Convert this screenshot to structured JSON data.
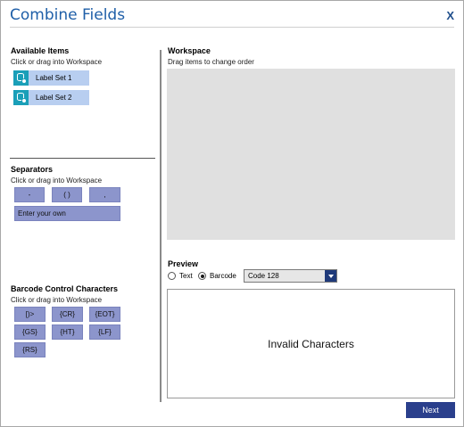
{
  "dialog": {
    "title": "Combine Fields",
    "close_label": "X"
  },
  "available_items": {
    "title": "Available Items",
    "subtitle": "Click or drag into Workspace",
    "items": [
      {
        "label": "Label Set 1",
        "icon": "database-icon"
      },
      {
        "label": "Label Set 2",
        "icon": "database-icon"
      }
    ]
  },
  "separators": {
    "title": "Separators",
    "subtitle": "Click or drag into Workspace",
    "items": [
      "-",
      "( )",
      ","
    ],
    "custom_label": "Enter your own"
  },
  "barcode_control": {
    "title": "Barcode Control Characters",
    "subtitle": "Click or drag into Workspace",
    "items": [
      "[)>",
      "{CR}",
      "{EOT}",
      "{GS}",
      "{HT}",
      "{LF}",
      "{RS}"
    ]
  },
  "workspace": {
    "title": "Workspace",
    "subtitle": "Drag items to change order"
  },
  "preview": {
    "title": "Preview",
    "options": [
      {
        "label": "Text",
        "selected": false
      },
      {
        "label": "Barcode",
        "selected": true
      }
    ],
    "symbology": "Code 128",
    "message": "Invalid Characters"
  },
  "footer": {
    "next_label": "Next"
  },
  "colors": {
    "title": "#1f5fa8",
    "item_button": "#b8cef0",
    "item_icon": "#1a9fb8",
    "chip": "#8c95cc",
    "workspace_bg": "#e0e0e0",
    "next_button": "#2a3f8c"
  }
}
